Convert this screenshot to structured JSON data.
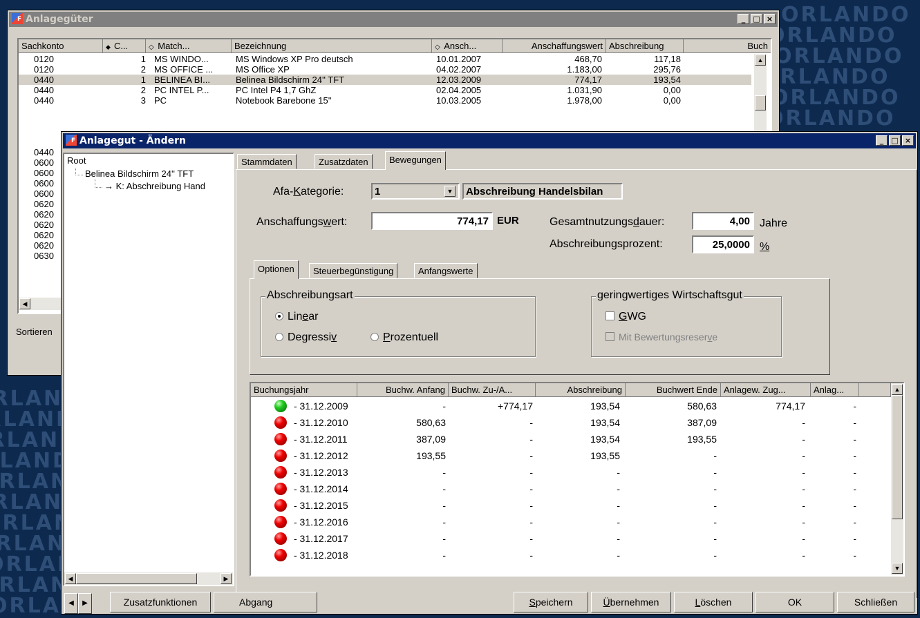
{
  "background": {
    "watermark": "ORLANDO"
  },
  "back_window": {
    "title": "Anlagegüter",
    "columns": [
      "Sachkonto",
      "C...",
      "Match...",
      "Bezeichnung",
      "Ansch...",
      "Anschaffungswert",
      "Abschreibung",
      "Buch"
    ],
    "rows": [
      {
        "konto": "0120",
        "c": "1",
        "match": "MS WINDO...",
        "bez": "MS Windows XP Pro deutsch",
        "datum": "10.01.2007",
        "wert": "468,70",
        "abschr": "117,18"
      },
      {
        "konto": "0120",
        "c": "2",
        "match": "MS OFFICE ...",
        "bez": "MS Office XP",
        "datum": "04.02.2007",
        "wert": "1.183,00",
        "abschr": "295,76"
      },
      {
        "konto": "0440",
        "c": "1",
        "match": "BELINEA BI...",
        "bez": "Belinea Bildschirm 24'' TFT",
        "datum": "12.03.2009",
        "wert": "774,17",
        "abschr": "193,54"
      },
      {
        "konto": "0440",
        "c": "2",
        "match": "PC INTEL P...",
        "bez": "PC Intel P4 1,7 GhZ",
        "datum": "02.04.2005",
        "wert": "1.031,90",
        "abschr": "0,00"
      },
      {
        "konto": "0440",
        "c": "3",
        "match": "PC",
        "bez": "Notebook Barebone 15''",
        "datum": "10.03.2005",
        "wert": "1.978,00",
        "abschr": "0,00"
      }
    ],
    "more_konten": [
      "0440",
      "0600",
      "0600",
      "0600",
      "0600",
      "0620",
      "0620",
      "0620",
      "0620",
      "0620",
      "0630"
    ],
    "sortieren_label": "Sortieren"
  },
  "dialog": {
    "title": "Anlagegut - Ändern",
    "tree": {
      "root": "Root",
      "item": "Belinea Bildschirm 24'' TFT",
      "sub": "K: Abschreibung Hand"
    },
    "tabs": [
      "Stammdaten",
      "Zusatzdaten",
      "Bewegungen"
    ],
    "afa_label_pre": "Afa-",
    "afa_label_u": "K",
    "afa_label_post": "ategorie:",
    "afa_value": "1",
    "afa_desc": "Abschreibung Handelsbilan",
    "anschaffungswert_pre": "Anschaffungs",
    "anschaffungswert_u": "w",
    "anschaffungswert_post": "ert:",
    "anschaffungswert_value": "774,17",
    "currency": "EUR",
    "gesamtnutzung_pre": "Gesamtnutzungs",
    "gesamtnutzung_u": "d",
    "gesamtnutzung_post": "auer:",
    "gesamtnutzung_value": "4,00",
    "jahre": "Jahre",
    "abschreibungsprozent_label": "Abschreibungsprozent:",
    "abschreibungsprozent_value": "25,0000",
    "percent": "%",
    "subtabs": [
      "Optionen",
      "Steuerbegünstigung",
      "Anfangswerte"
    ],
    "abschreibungsart": {
      "title": "Abschreibungsart",
      "linear_pre": "Lin",
      "linear_u": "e",
      "linear_post": "ar",
      "degressiv_pre": "Degressi",
      "degressiv_u": "v",
      "degressiv_post": "",
      "prozentuell_pre": "",
      "prozentuell_u": "P",
      "prozentuell_post": "rozentuell",
      "selected": "Linear"
    },
    "gwg": {
      "title": "geringwertiges Wirtschaftsgut",
      "gwg_u": "G",
      "gwg_post": "WG",
      "reserve_pre": "Mit Bewertungsreser",
      "reserve_u": "v",
      "reserve_post": "e"
    },
    "table": {
      "columns": [
        "Buchungsjahr",
        "Buchw. Anfang",
        "Buchw. Zu-/A...",
        "Abschreibung",
        "Buchwert Ende",
        "Anlagew. Zug...",
        "Anlag..."
      ],
      "rows": [
        {
          "status": "green",
          "jahr": "- 31.12.2009",
          "anfang": "-",
          "zu": "+774,17",
          "abschr": "193,54",
          "ende": "580,63",
          "zug": "774,17",
          "anl": "-"
        },
        {
          "status": "red",
          "jahr": "- 31.12.2010",
          "anfang": "580,63",
          "zu": "-",
          "abschr": "193,54",
          "ende": "387,09",
          "zug": "-",
          "anl": "-"
        },
        {
          "status": "red",
          "jahr": "- 31.12.2011",
          "anfang": "387,09",
          "zu": "-",
          "abschr": "193,54",
          "ende": "193,55",
          "zug": "-",
          "anl": "-"
        },
        {
          "status": "red",
          "jahr": "- 31.12.2012",
          "anfang": "193,55",
          "zu": "-",
          "abschr": "193,55",
          "ende": "-",
          "zug": "-",
          "anl": "-"
        },
        {
          "status": "red",
          "jahr": "- 31.12.2013",
          "anfang": "-",
          "zu": "-",
          "abschr": "-",
          "ende": "-",
          "zug": "-",
          "anl": "-"
        },
        {
          "status": "red",
          "jahr": "- 31.12.2014",
          "anfang": "-",
          "zu": "-",
          "abschr": "-",
          "ende": "-",
          "zug": "-",
          "anl": "-"
        },
        {
          "status": "red",
          "jahr": "- 31.12.2015",
          "anfang": "-",
          "zu": "-",
          "abschr": "-",
          "ende": "-",
          "zug": "-",
          "anl": "-"
        },
        {
          "status": "red",
          "jahr": "- 31.12.2016",
          "anfang": "-",
          "zu": "-",
          "abschr": "-",
          "ende": "-",
          "zug": "-",
          "anl": "-"
        },
        {
          "status": "red",
          "jahr": "- 31.12.2017",
          "anfang": "-",
          "zu": "-",
          "abschr": "-",
          "ende": "-",
          "zug": "-",
          "anl": "-"
        },
        {
          "status": "red",
          "jahr": "- 31.12.2018",
          "anfang": "-",
          "zu": "-",
          "abschr": "-",
          "ende": "-",
          "zug": "-",
          "anl": "-"
        }
      ]
    },
    "buttons": {
      "zusatzfunktionen": "Zusatzfunktionen",
      "abgang": "Abgang",
      "speichern_u": "S",
      "speichern_post": "peichern",
      "uebernehmen_u": "Ü",
      "uebernehmen_post": "bernehmen",
      "loeschen_u": "L",
      "loeschen_post": "öschen",
      "ok": "OK",
      "schliessen": "Schließen"
    }
  }
}
